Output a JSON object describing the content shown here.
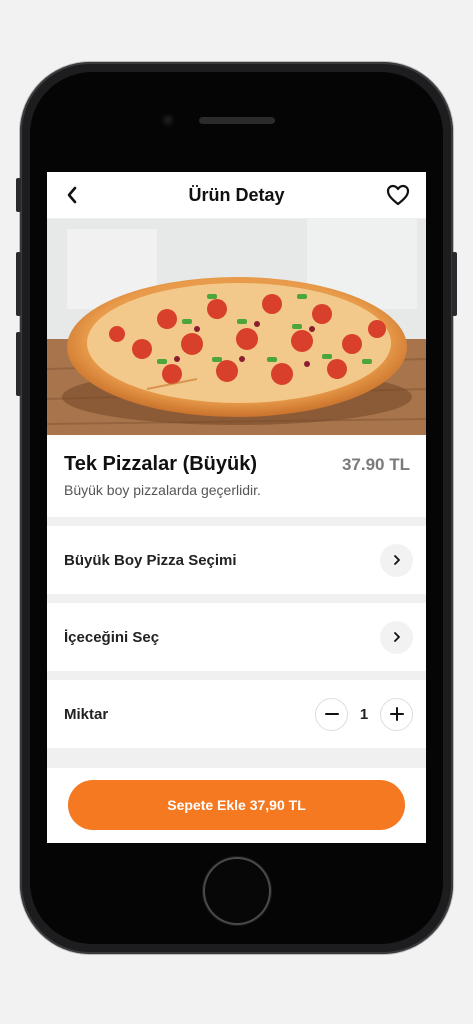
{
  "header": {
    "title": "Ürün Detay"
  },
  "icons": {
    "back": "chevron-left-icon",
    "favorite": "heart-icon",
    "row_arrow": "chevron-right-icon",
    "minus": "minus-icon",
    "plus": "plus-icon"
  },
  "product": {
    "name": "Tek Pizzalar (Büyük)",
    "price": "37.90 TL",
    "description": "Büyük boy pizzalarda geçerlidir."
  },
  "options": [
    {
      "label": "Büyük Boy Pizza Seçimi"
    },
    {
      "label": "İçeceğini Seç"
    }
  ],
  "quantity": {
    "label": "Miktar",
    "value": "1"
  },
  "cta": {
    "label": "Sepete Ekle 37,90 TL"
  },
  "colors": {
    "accent": "#f47920",
    "background": "#f0f0f0"
  }
}
